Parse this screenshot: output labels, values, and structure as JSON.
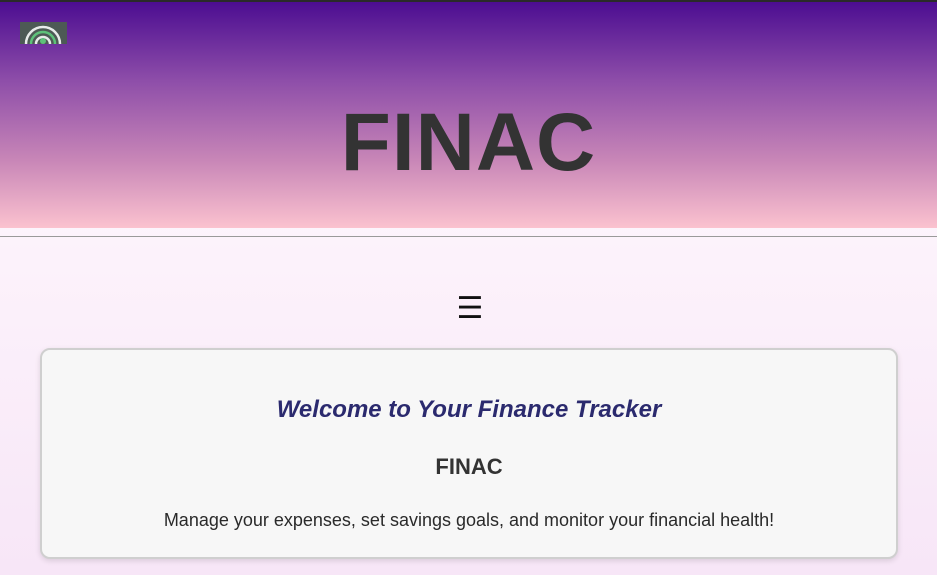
{
  "header": {
    "title": "FINAC",
    "logo_icon": "finac-logo-icon"
  },
  "nav": {
    "menu_glyph": "☰",
    "menu_icon": "hamburger-menu-icon"
  },
  "welcome_card": {
    "heading": "Welcome to Your Finance Tracker",
    "brand": "FINAC",
    "description": "Manage your expenses, set savings goals, and monitor your financial health!"
  },
  "colors": {
    "header_top": "#4c0d91",
    "header_bottom": "#fbc2cf",
    "welcome_heading": "#2b2a6e",
    "title_text": "#333333",
    "card_background": "#f7f7f7"
  }
}
